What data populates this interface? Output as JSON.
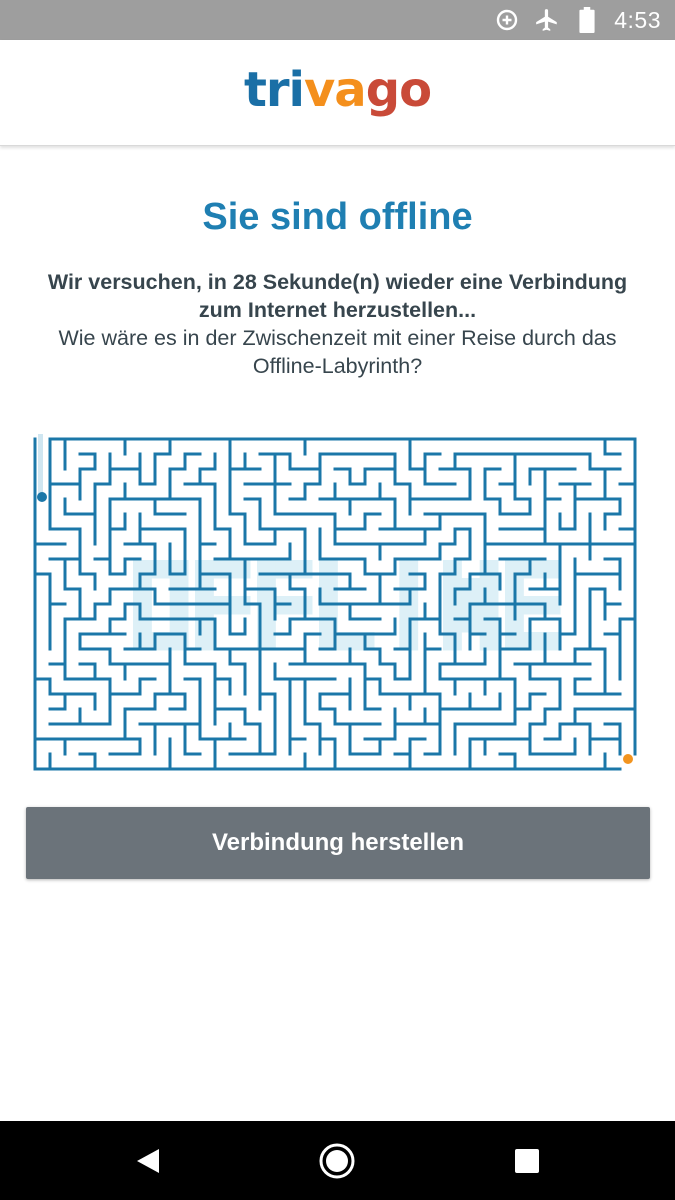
{
  "status_bar": {
    "time": "4:53",
    "icons": [
      "data-saver-icon",
      "airplane-mode-icon",
      "battery-icon"
    ]
  },
  "header": {
    "logo": {
      "parts": [
        "tri",
        "va",
        "go"
      ],
      "colors": [
        "#1a6fa6",
        "#f48f1c",
        "#c94a38"
      ]
    }
  },
  "content": {
    "title": "Sie sind offline",
    "message_bold": "Wir versuchen, in 28 Sekunde(n) wieder eine Verbindung zum Internet herzustellen...",
    "message_regular": "Wie wäre es in der Zwischenzeit mit einer Reise durch das Offline-Labyrinth?",
    "maze": {
      "word": "OFFLINE",
      "wall_color": "#1b77a8",
      "letter_fill": "#ddf0f7",
      "start_color": "#1b77a8",
      "goal_color": "#f2941f"
    },
    "button_label": "Verbindung herstellen"
  },
  "nav_bar": {
    "icons": [
      "back-icon",
      "home-icon",
      "recents-icon"
    ]
  },
  "colors": {
    "accent": "#1f7fb2",
    "button": "#6b737a",
    "status_bar": "#9e9e9e"
  }
}
